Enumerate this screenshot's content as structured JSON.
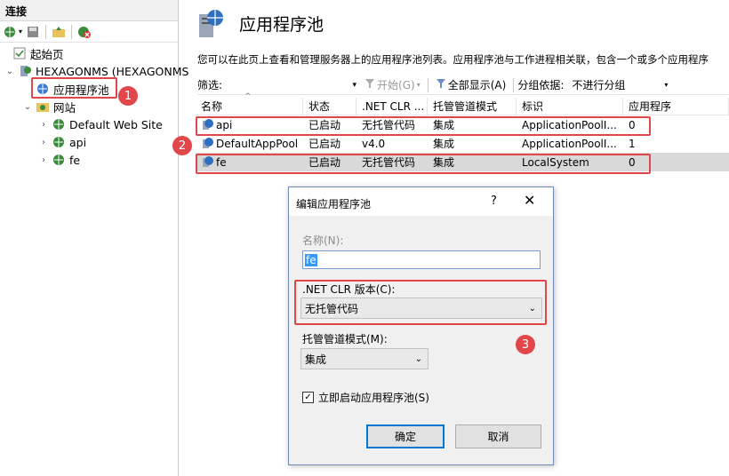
{
  "left": {
    "header": "连接",
    "tree": {
      "start_page": "起始页",
      "server": "HEXAGONMS (HEXAGONMS",
      "app_pools": "应用程序池",
      "sites": "网站",
      "site_items": [
        "Default Web Site",
        "api",
        "fe"
      ]
    }
  },
  "main": {
    "title": "应用程序池",
    "description": "您可以在此页上查看和管理服务器上的应用程序池列表。应用程序池与工作进程相关联，包含一个或多个应用程序",
    "filter": {
      "label": "筛选:",
      "start_button": "开始(G)",
      "show_all_button": "全部显示(A)",
      "group_label": "分组依据:",
      "group_value": "不进行分组"
    },
    "columns": [
      "名称",
      "状态",
      ".NET CLR ...",
      "托管管道模式",
      "标识",
      "应用程序"
    ],
    "rows": [
      {
        "name": "api",
        "status": "已启动",
        "clr": "无托管代码",
        "pipeline": "集成",
        "identity": "ApplicationPoolI...",
        "apps": "0"
      },
      {
        "name": "DefaultAppPool",
        "status": "已启动",
        "clr": "v4.0",
        "pipeline": "集成",
        "identity": "ApplicationPoolI...",
        "apps": "1"
      },
      {
        "name": "fe",
        "status": "已启动",
        "clr": "无托管代码",
        "pipeline": "集成",
        "identity": "LocalSystem",
        "apps": "0"
      }
    ]
  },
  "dialog": {
    "title": "编辑应用程序池",
    "help": "?",
    "name_label": "名称(N):",
    "name_value": "fe",
    "clr_label": ".NET CLR 版本(C):",
    "clr_value": "无托管代码",
    "pipeline_label": "托管管道模式(M):",
    "pipeline_value": "集成",
    "autostart_label": "立即启动应用程序池(S)",
    "autostart_checked": true,
    "ok_label": "确定",
    "cancel_label": "取消"
  },
  "badges": [
    "1",
    "2",
    "3"
  ],
  "colors": {
    "highlight_red": "#e0464a",
    "selection_gray": "#d9d9d9",
    "focus_blue": "#0078d7"
  }
}
